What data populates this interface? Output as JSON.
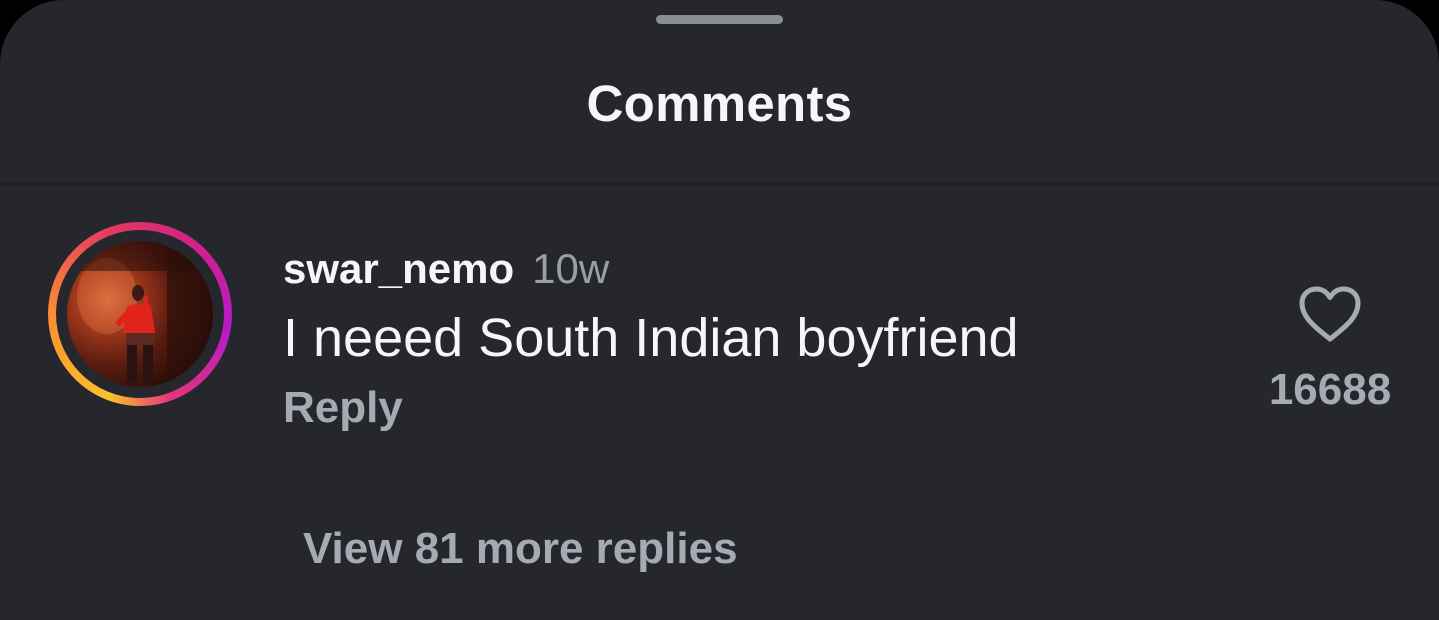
{
  "sheet": {
    "title": "Comments"
  },
  "comment": {
    "username": "swar_nemo",
    "timestamp": "10w",
    "text": "I neeed South Indian boyfriend",
    "reply_label": "Reply",
    "like_count": "16688",
    "avatar_has_story_ring": true
  },
  "replies": {
    "view_more_label": "View 81 more replies"
  },
  "colors": {
    "background": "#25272d",
    "primary_text": "#f5f6f7",
    "secondary_text": "#a6aab2",
    "story_ring_start": "#f9c22d",
    "story_ring_end": "#b61bc8"
  },
  "icons": {
    "like": "heart-outline-icon",
    "handle": "drag-handle"
  }
}
